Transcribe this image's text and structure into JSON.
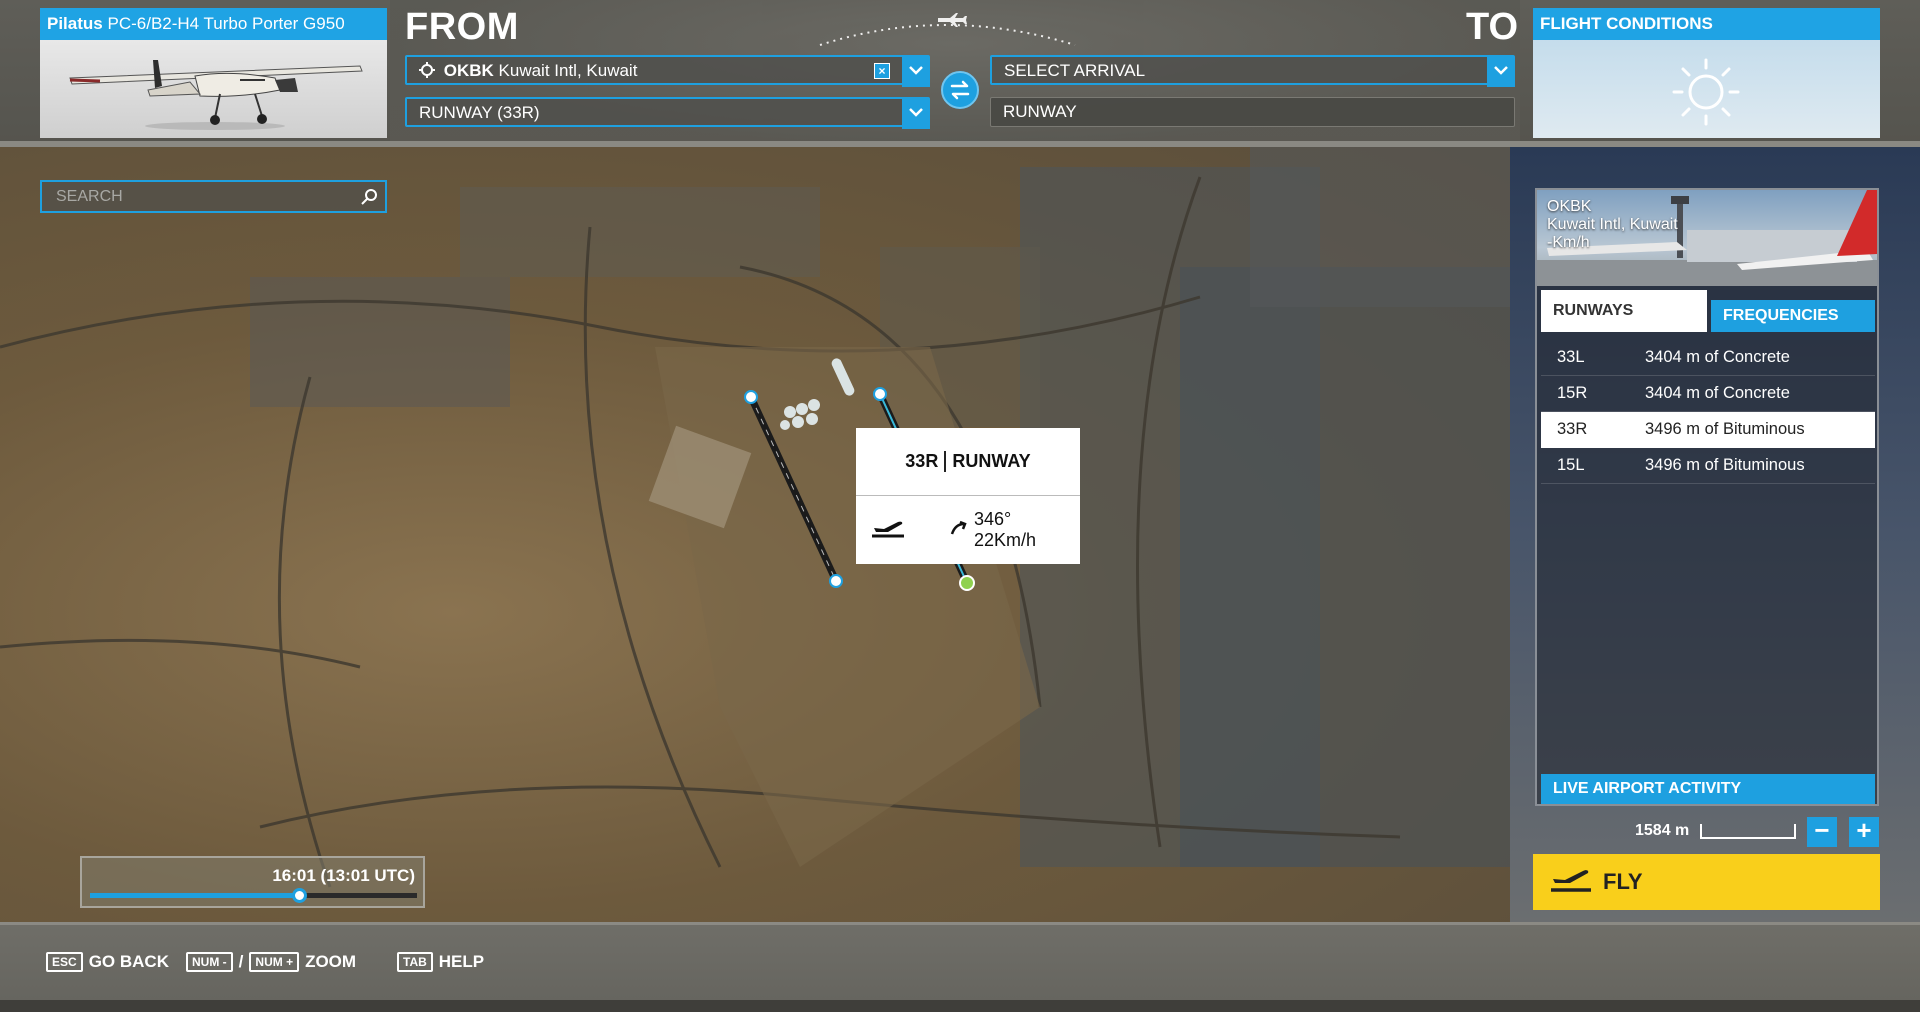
{
  "aircraft": {
    "make": "Pilatus",
    "model": "PC-6/B2-H4 Turbo Porter G950"
  },
  "from": {
    "label": "FROM",
    "airport_code": "OKBK",
    "airport_name": "Kuwait Intl, Kuwait",
    "runway": "RUNWAY (33R)"
  },
  "to": {
    "label": "TO",
    "arrival_placeholder": "SELECT ARRIVAL",
    "runway_placeholder": "RUNWAY"
  },
  "flight_conditions": {
    "title": "FLIGHT CONDITIONS",
    "weather_icon": "sun-icon"
  },
  "search": {
    "placeholder": "SEARCH"
  },
  "runway_popup": {
    "runway": "33R",
    "label": "RUNWAY",
    "wind": "346° 22Km/h"
  },
  "time": {
    "display": "16:01 (13:01 UTC)",
    "slider_fraction": 0.64
  },
  "airport_panel": {
    "code": "OKBK",
    "name": "Kuwait Intl, Kuwait",
    "wind_line": "-Km/h",
    "tabs": [
      "RUNWAYS",
      "FREQUENCIES"
    ],
    "runways": [
      {
        "id": "33L",
        "desc": "3404 m of Concrete",
        "selected": false
      },
      {
        "id": "15R",
        "desc": "3404 m of Concrete",
        "selected": false
      },
      {
        "id": "33R",
        "desc": "3496 m of Bituminous",
        "selected": true
      },
      {
        "id": "15L",
        "desc": "3496 m of Bituminous",
        "selected": false
      }
    ],
    "live_activity": "LIVE AIRPORT ACTIVITY"
  },
  "map_scale": {
    "label": "1584 m"
  },
  "zoom": {
    "minus": "−",
    "plus": "+"
  },
  "fly": {
    "label": "FLY"
  },
  "hints": {
    "esc_key": "ESC",
    "go_back": "GO BACK",
    "num_minus": "NUM -",
    "slash": "/",
    "num_plus": "NUM +",
    "zoom": "ZOOM",
    "tab_key": "TAB",
    "help": "HELP"
  },
  "colors": {
    "accent": "#1ea0e0",
    "fly": "#f9cf1b"
  }
}
